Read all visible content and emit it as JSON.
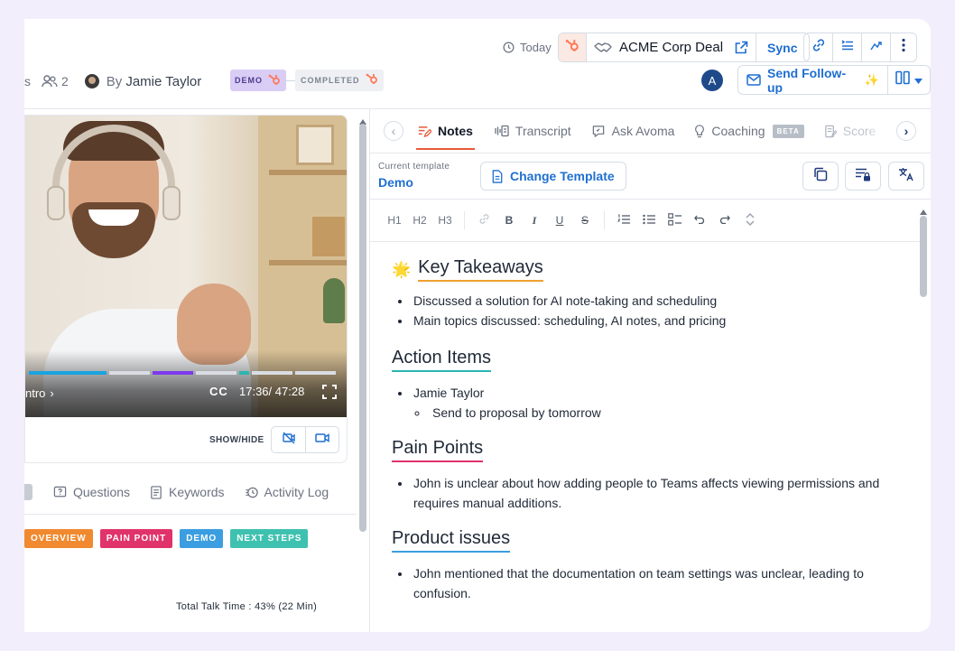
{
  "header": {
    "participants_partial": "s",
    "participant_count": "2",
    "by_prefix": "By",
    "owner": "Jamie Taylor",
    "stage_demo": "DEMO",
    "stage_completed": "COMPLETED",
    "date_label": "Today",
    "deal_name": "ACME Corp Deal",
    "sync_label": "Sync",
    "avatar_letter": "A",
    "send_followup_label": "Send Follow-up",
    "colors": {
      "accent": "#1f6fd1",
      "hubspot": "#ff7a59",
      "demo_bg": "#d9cdf5"
    }
  },
  "video": {
    "chapter_label": "ntro",
    "cc_label": "CC",
    "time_current": "17:36",
    "time_total": "47:28",
    "show_hide_label": "SHOW/HIDE",
    "progress_segments": [
      {
        "color": "#1aa3e0",
        "fraction": 0.26
      },
      {
        "color": "#d9dde3",
        "fraction": 0.14
      },
      {
        "color": "#7c3aed",
        "fraction": 0.14
      },
      {
        "color": "#d9dde3",
        "fraction": 0.14
      },
      {
        "color": "#2bb5b0",
        "fraction": 0.04
      },
      {
        "color": "#d9dde3",
        "fraction": 0.14
      },
      {
        "color": "#d9dde3",
        "fraction": 0.14
      }
    ]
  },
  "left_tabs": [
    {
      "label": "Questions",
      "icon": "question-icon"
    },
    {
      "label": "Keywords",
      "icon": "keywords-icon"
    },
    {
      "label": "Activity Log",
      "icon": "history-icon"
    }
  ],
  "topic_tags": [
    {
      "label": "OVERVIEW",
      "color": "#f0892f"
    },
    {
      "label": "PAIN POINT",
      "color": "#e0336b"
    },
    {
      "label": "DEMO",
      "color": "#3b9ee0"
    },
    {
      "label": "NEXT STEPS",
      "color": "#3fc1b0"
    }
  ],
  "talk_time": "Total Talk Time : 43% (22 Min)",
  "right_tabs": [
    {
      "label": "Notes",
      "icon": "notes-icon",
      "active": true
    },
    {
      "label": "Transcript",
      "icon": "transcript-icon"
    },
    {
      "label": "Ask Avoma",
      "icon": "ask-icon"
    },
    {
      "label": "Coaching",
      "icon": "bulb-icon",
      "badge": "BETA"
    },
    {
      "label": "Score",
      "icon": "score-icon"
    }
  ],
  "template": {
    "caption": "Current template",
    "name": "Demo",
    "change_label": "Change Template"
  },
  "toolbar": {
    "h1": "H1",
    "h2": "H2",
    "h3": "H3",
    "bold": "B",
    "italic": "I",
    "underline": "U",
    "strike": "S"
  },
  "notes": {
    "takeaways_emoji": "🌟",
    "takeaways_title": "Key Takeaways",
    "takeaways": [
      "Discussed a solution for AI note-taking and scheduling",
      "Main topics discussed: scheduling, AI notes, and pricing"
    ],
    "action_title": "Action Items",
    "action_person": "Jamie Taylor",
    "action_sub": "Send to proposal by tomorrow",
    "pain_title": "Pain Points",
    "pain_items": [
      "John is unclear about how adding people to Teams affects viewing permissions and requires manual additions."
    ],
    "product_title": "Product issues",
    "product_items": [
      "John mentioned that the documentation on team settings was unclear, leading to confusion."
    ],
    "colors": {
      "takeaways": "#f0a030",
      "action": "#2bb5b0",
      "pain": "#e0336b",
      "product": "#3b9ee0"
    }
  }
}
